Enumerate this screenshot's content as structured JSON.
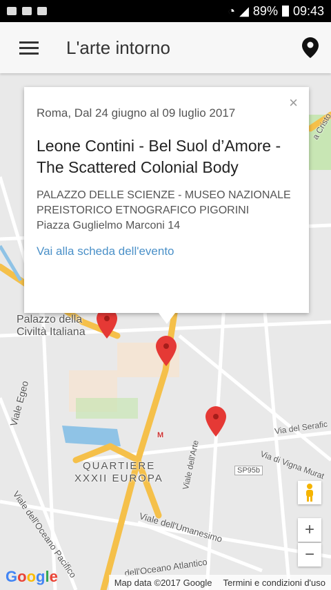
{
  "status_bar": {
    "battery": "89%",
    "time": "09:43"
  },
  "app_bar": {
    "title": "L'arte intorno"
  },
  "info_window": {
    "close": "×",
    "date": "Roma, Dal 24 giugno al 09 luglio 2017",
    "title": "Leone Contini - Bel Suol d’Amore - The Scattered Colonial Body",
    "venue": "PALAZZO DELLE SCIENZE - MUSEO NAZIONALE PREISTORICO ETNOGRAFICO PIGORINI",
    "address": "Piazza Guglielmo Marconi 14",
    "link": "Vai alla scheda dell'evento"
  },
  "map_labels": {
    "palazzo": "Palazzo della",
    "palazzo2": "Civiltà Italiana",
    "quartiere1": "QUARTIERE",
    "quartiere2": "XXXII EUROPA",
    "viale_egeo": "Viale Egeo",
    "viale_arte": "Viale dell'Arte",
    "via_serafico": "Via del Serafic",
    "via_vigna": "Via di Vigna Murat",
    "sp95b": "SP95b",
    "umanesimo": "Viale dell'Umanesimo",
    "oceano_pacifico": "Viale dell'Oceano Pacifico",
    "oceano_atlantico": "dell'Oceano Atlantico",
    "cristo": "a Cristo",
    "metro": "M"
  },
  "map_controls": {
    "zoom_in": "+",
    "zoom_out": "−"
  },
  "map_footer": {
    "logo": "Google",
    "map_data": "Map data ©2017 Google",
    "terms": "Termini e condizioni d'uso"
  },
  "colors": {
    "accent": "#4a90c8",
    "marker": "#e53935",
    "road_major": "#f5c04a"
  }
}
